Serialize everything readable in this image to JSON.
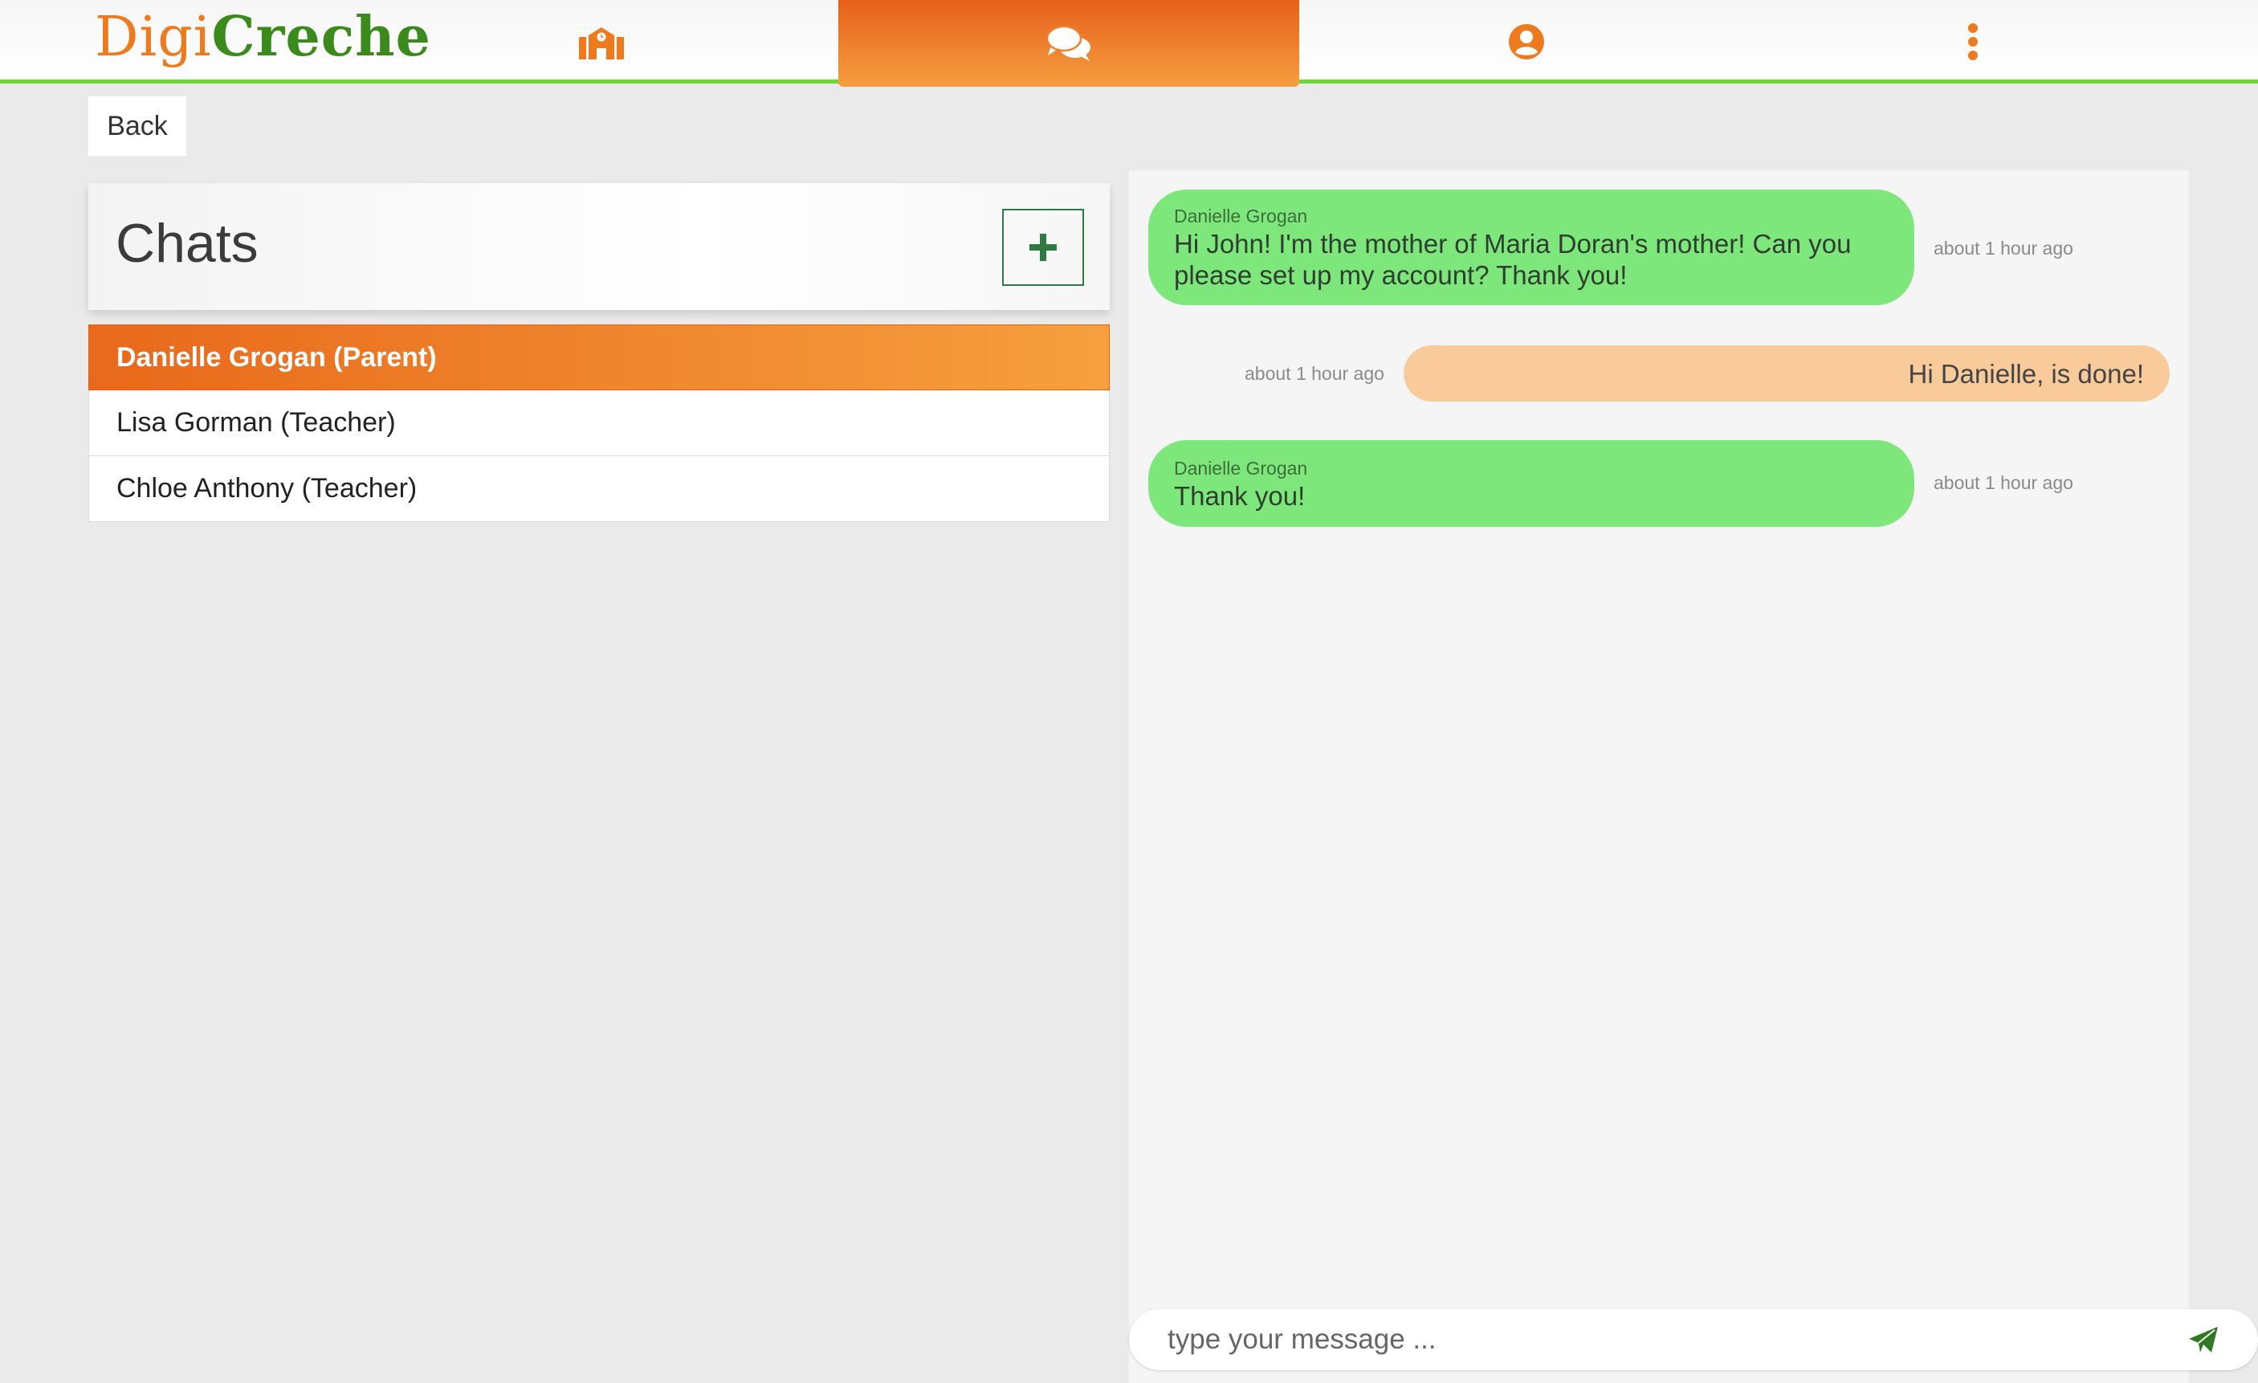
{
  "app": {
    "logo_part1": "Digi",
    "logo_part2": "Creche"
  },
  "nav": {
    "tabs": [
      {
        "icon": "school-icon",
        "active": false
      },
      {
        "icon": "chat-bubbles-icon",
        "active": true
      },
      {
        "icon": "user-circle-icon",
        "active": false
      },
      {
        "icon": "more-vertical-icon",
        "active": false
      }
    ]
  },
  "back_label": "Back",
  "chats": {
    "title": "Chats",
    "add_icon": "plus-icon",
    "items": [
      {
        "label": "Danielle Grogan (Parent)",
        "active": true
      },
      {
        "label": "Lisa Gorman (Teacher)",
        "active": false
      },
      {
        "label": "Chloe Anthony (Teacher)",
        "active": false
      }
    ]
  },
  "conversation": {
    "messages": [
      {
        "direction": "incoming",
        "sender": "Danielle Grogan",
        "text": "Hi John! I'm the mother of Maria Doran's mother! Can you please set up my account? Thank you!",
        "time": "about 1 hour ago"
      },
      {
        "direction": "outgoing",
        "sender": "",
        "text": "Hi Danielle, is done!",
        "time": "about 1 hour ago"
      },
      {
        "direction": "incoming",
        "sender": "Danielle Grogan",
        "text": "Thank you!",
        "time": "about 1 hour ago"
      }
    ]
  },
  "composer": {
    "placeholder": "type your message ...",
    "value": "",
    "send_icon": "send-icon"
  },
  "colors": {
    "brand_orange": "#ee7a1e",
    "brand_green": "#3a8a1c",
    "accent_green_line": "#6fd63a",
    "incoming_bubble": "#7de77c",
    "outgoing_bubble": "#f9cb9b"
  }
}
